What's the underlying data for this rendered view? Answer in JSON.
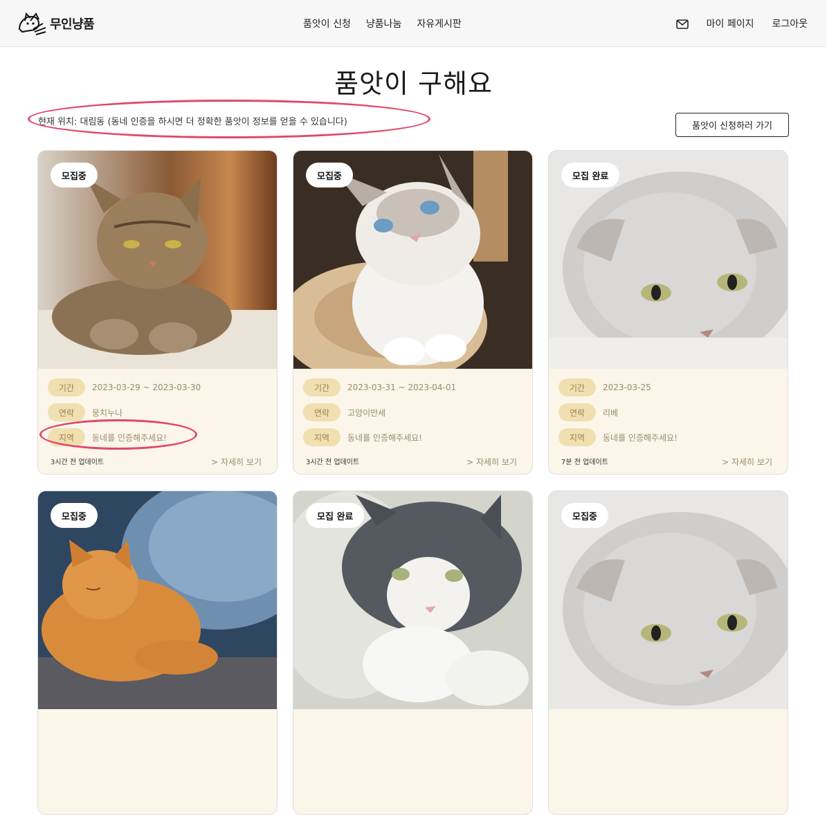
{
  "header": {
    "logo_text": "무인냥품",
    "nav": [
      "품앗이 신청",
      "냥품나눔",
      "자유게시판"
    ],
    "mail_icon": "mail-icon",
    "mypage": "마이 페이지",
    "logout": "로그아웃"
  },
  "page_title": "품앗이 구해요",
  "location_text": "현재 위치: 대림동 (동네 인증을 하시면 더 정확한 품앗이 정보를 얻을 수 있습니다)",
  "apply_button": "품앗이 신청하러 가기",
  "labels": {
    "period": "기간",
    "contact": "연락",
    "region": "지역",
    "detail": "> 자세히 보기"
  },
  "colors": {
    "accent_highlight": "#e0486c",
    "card_bg": "#fbf6e9",
    "tag_bg": "#f0dfb0"
  },
  "cards": [
    {
      "status": "모집중",
      "period": "2023-03-29 ~ 2023-03-30",
      "contact": "뭉치누나",
      "region": "동네를 인증해주세요!",
      "updated": "3시간 전 업데이트"
    },
    {
      "status": "모집중",
      "period": "2023-03-31 ~ 2023-04-01",
      "contact": "고양이만세",
      "region": "동네를 인증해주세요!",
      "updated": "3시간 전 업데이트"
    },
    {
      "status": "모집 완료",
      "period": "2023-03-25",
      "contact": "리베",
      "region": "동네를 인증해주세요!",
      "updated": "7분 전 업데이트"
    },
    {
      "status": "모집중"
    },
    {
      "status": "모집 완료"
    },
    {
      "status": "모집중"
    }
  ]
}
